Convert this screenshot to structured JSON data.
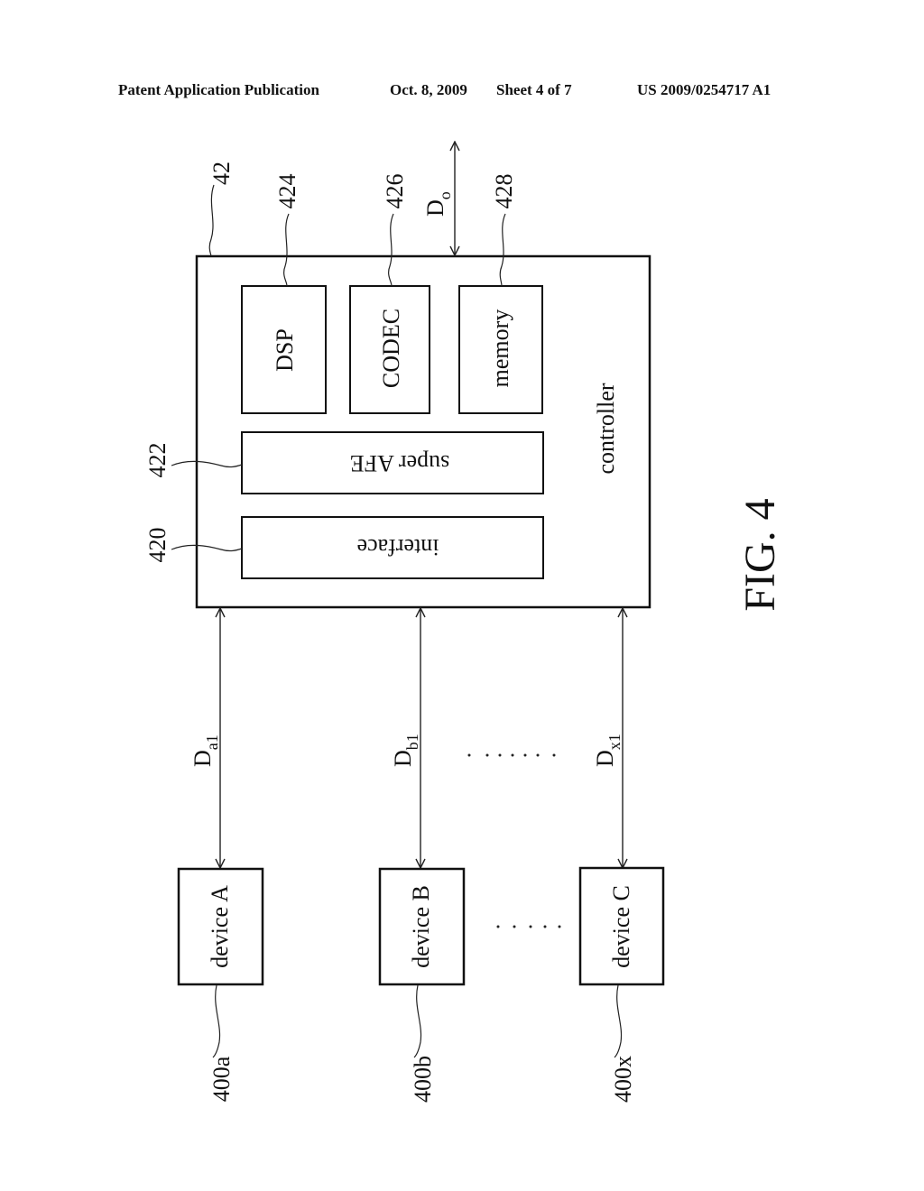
{
  "header": {
    "publication": "Patent Application Publication",
    "date": "Oct. 8, 2009",
    "sheet": "Sheet 4 of 7",
    "number": "US 2009/0254717 A1"
  },
  "figure": {
    "caption": "FIG. 4",
    "controller": {
      "label": "controller",
      "ref": "42"
    },
    "blocks": [
      {
        "id": "dsp",
        "label": "DSP",
        "ref": "424"
      },
      {
        "id": "codec",
        "label": "CODEC",
        "ref": "426"
      },
      {
        "id": "memory",
        "label": "memory",
        "ref": "428"
      },
      {
        "id": "super-afe",
        "label": "super AFE",
        "ref": "422"
      },
      {
        "id": "interface",
        "label": "interface",
        "ref": "420"
      }
    ],
    "output_signal": {
      "main": "D",
      "sub": "o"
    },
    "devices": [
      {
        "label": "device A",
        "ref": "400a",
        "signal_main": "D",
        "signal_sub": "a1"
      },
      {
        "label": "device B",
        "ref": "400b",
        "signal_main": "D",
        "signal_sub": "b1"
      },
      {
        "label": "device C",
        "ref": "400x",
        "signal_main": "D",
        "signal_sub": "x1"
      }
    ]
  }
}
